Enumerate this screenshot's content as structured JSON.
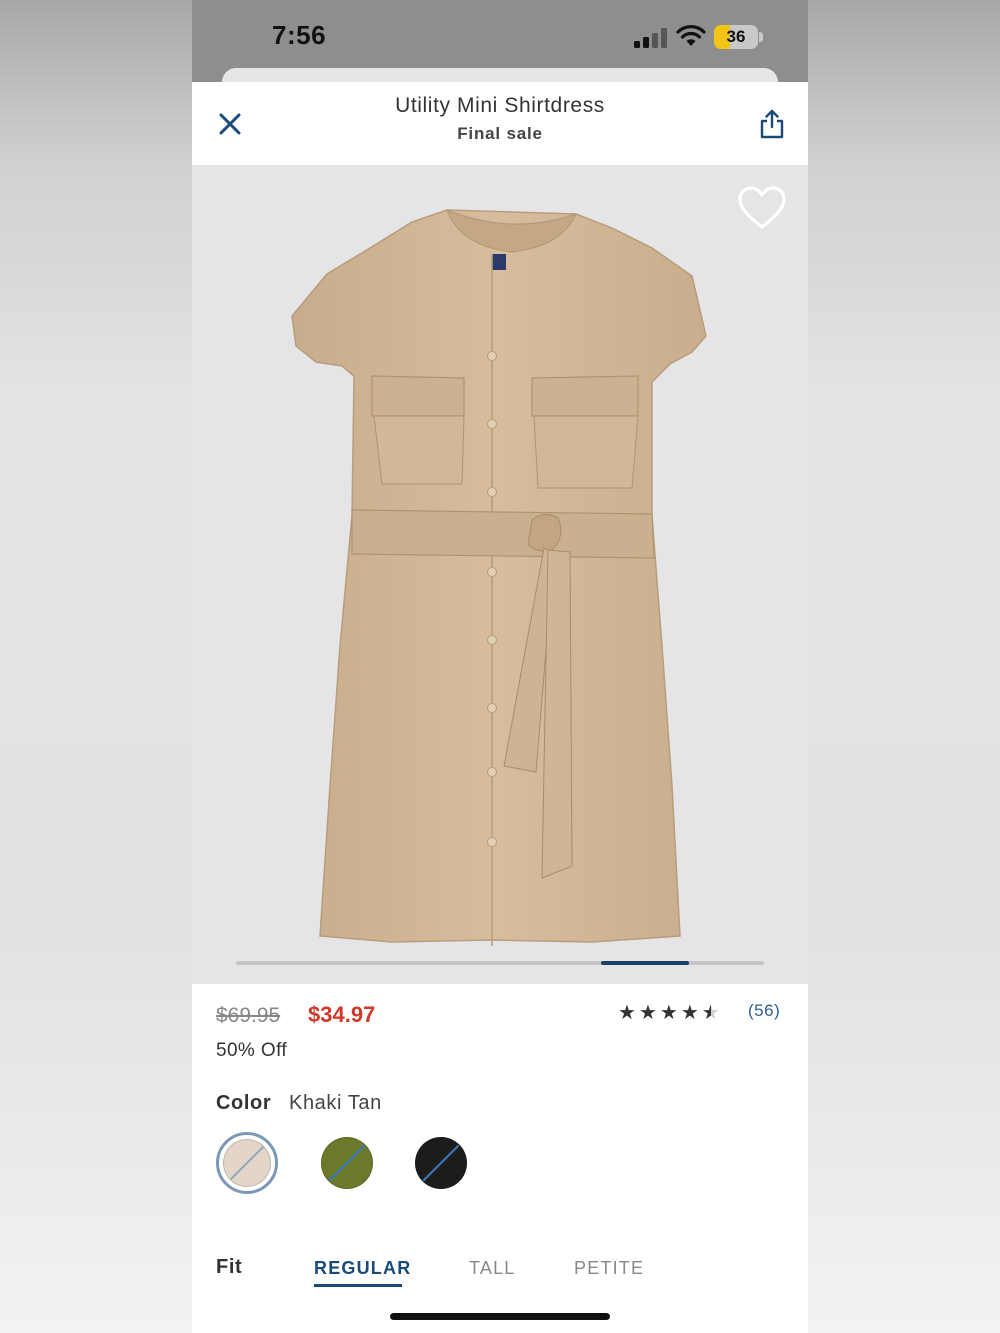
{
  "status_bar": {
    "time": "7:56",
    "battery_level": "36",
    "battery_fraction": 0.36,
    "battery_color": "#f2c417"
  },
  "header": {
    "title": "Utility Mini Shirtdress",
    "subtitle": "Final sale",
    "close_icon": "close-icon",
    "share_icon": "share-icon"
  },
  "product_image": {
    "favorite_icon": "heart-outline-icon",
    "background_color": "#e5e5e7",
    "dress_color": "#d4bb9b",
    "carousel_position": 0.83
  },
  "pricing": {
    "original_price": "$69.95",
    "sale_price": "$34.97",
    "discount_label": "50% Off",
    "sale_color": "#d1382a"
  },
  "rating": {
    "stars": 4.5,
    "review_count": "(56)"
  },
  "color": {
    "label": "Color",
    "selected_name": "Khaki Tan",
    "swatches": [
      {
        "name": "khaki-tan",
        "hex": "#e3d6c9",
        "selected": true,
        "unavailable_slash": true
      },
      {
        "name": "olive",
        "hex": "#6b7a2a",
        "selected": false,
        "unavailable_slash": true
      },
      {
        "name": "black",
        "hex": "#1c1c1c",
        "selected": false,
        "unavailable_slash": true
      }
    ]
  },
  "fit": {
    "label": "Fit",
    "options": [
      "REGULAR",
      "TALL",
      "PETITE"
    ],
    "selected": "REGULAR",
    "accent_color": "#1a4a78"
  }
}
